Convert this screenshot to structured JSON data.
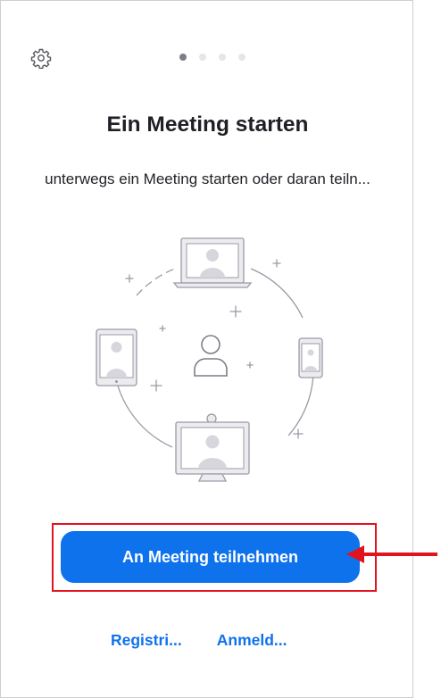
{
  "header": {
    "settings_icon": "gear-icon",
    "page_dots": 4,
    "active_dot": 1
  },
  "hero": {
    "title": "Ein Meeting starten",
    "subtitle": "unterwegs ein Meeting starten oder daran teiln..."
  },
  "actions": {
    "join_label": "An Meeting teilnehmen",
    "register_label": "Registri...",
    "login_label": "Anmeld..."
  },
  "colors": {
    "accent": "#0e72ed",
    "annotation": "#e0141e"
  }
}
